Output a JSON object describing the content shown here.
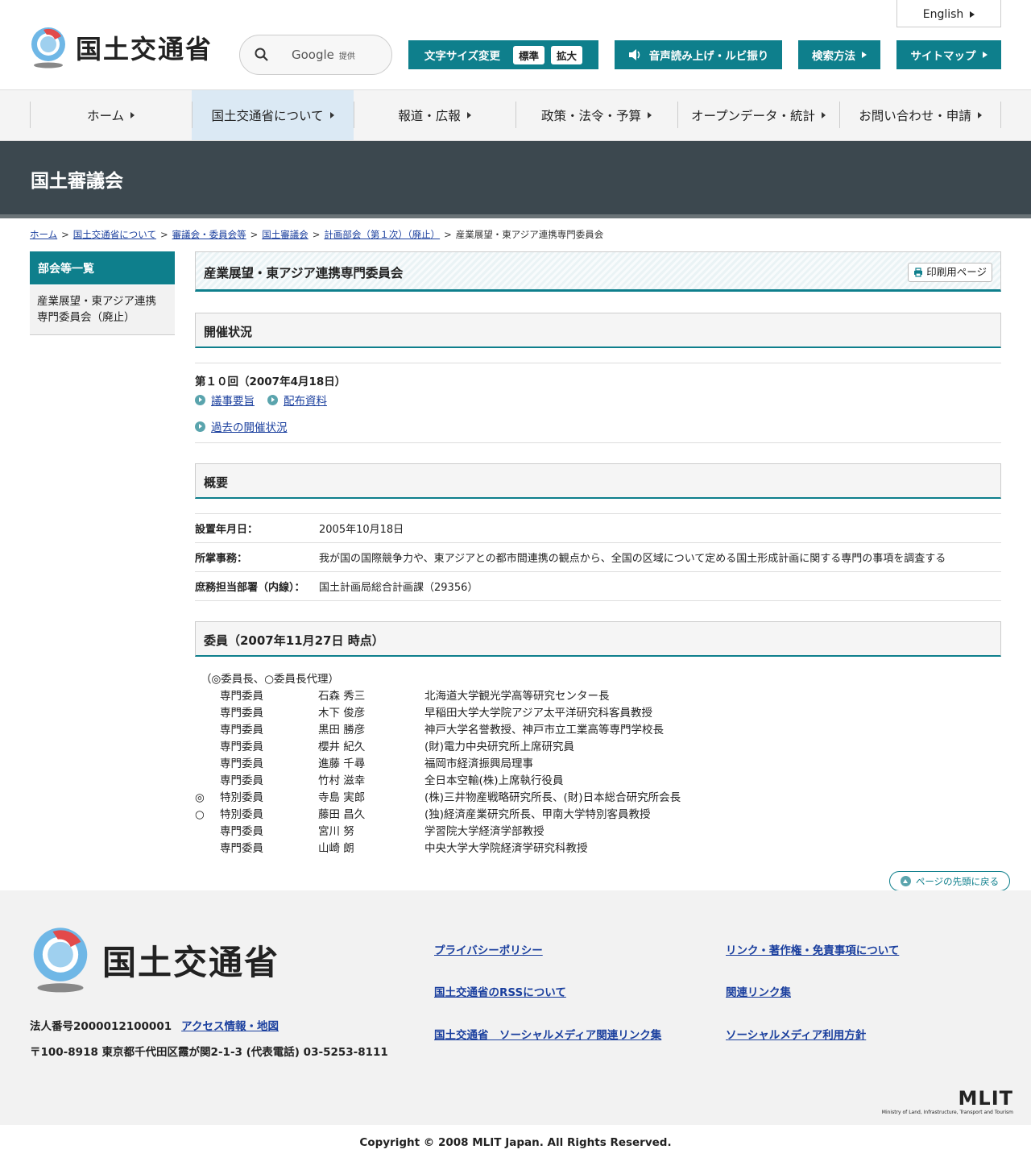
{
  "header": {
    "logo_text": "国土交通省",
    "search_label": "Google",
    "search_sub": "提供",
    "english": "English",
    "font_size_label": "文字サイズ変更",
    "font_standard": "標準",
    "font_large": "拡大",
    "voice": "音声読み上げ・ルビ振り",
    "search_method": "検索方法",
    "sitemap": "サイトマップ"
  },
  "nav": {
    "items": [
      {
        "label": "ホーム"
      },
      {
        "label": "国土交通省について"
      },
      {
        "label": "報道・広報"
      },
      {
        "label": "政策・法令・予算"
      },
      {
        "label": "オープンデータ・統計"
      },
      {
        "label": "お問い合わせ・申請"
      }
    ]
  },
  "band_title": "国土審議会",
  "breadcrumb": {
    "items": [
      "ホーム",
      "国土交通省について",
      "審議会・委員会等",
      "国土審議会",
      "計画部会（第１次）（廃止）"
    ],
    "current": "産業展望・東アジア連携専門委員会"
  },
  "sidebar": {
    "heading": "部会等一覧",
    "item_line1": "産業展望・東アジア連携",
    "item_line2": "専門委員会（廃止）"
  },
  "main": {
    "title": "産業展望・東アジア連携専門委員会",
    "print": "印刷用ページ",
    "sec1": "開催状況",
    "meeting": "第１０回（2007年4月18日）",
    "link_minutes": "議事要旨",
    "link_materials": "配布資料",
    "link_past": "過去の開催状況",
    "sec2": "概要",
    "overview": [
      {
        "k": "設置年月日：",
        "v": "2005年10月18日"
      },
      {
        "k": "所掌事務：",
        "v": "我が国の国際競争力や、東アジアとの都市間連携の観点から、全国の区域について定める国土形成計画に関する専門の事項を調査する"
      },
      {
        "k": "庶務担当部署（内線）：",
        "v": "国土計画局総合計画課（29356）"
      }
    ],
    "sec3": "委員（2007年11月27日 時点）",
    "legend": "（◎委員長、○委員長代理）",
    "members": [
      {
        "mark": "",
        "role": "専門委員",
        "name": "石森 秀三",
        "title": "北海道大学観光学高等研究センター長"
      },
      {
        "mark": "",
        "role": "専門委員",
        "name": "木下 俊彦",
        "title": "早稲田大学大学院アジア太平洋研究科客員教授"
      },
      {
        "mark": "",
        "role": "専門委員",
        "name": "黒田 勝彦",
        "title": "神戸大学名誉教授、神戸市立工業高等専門学校長"
      },
      {
        "mark": "",
        "role": "専門委員",
        "name": "櫻井 紀久",
        "title": "(財)電力中央研究所上席研究員"
      },
      {
        "mark": "",
        "role": "専門委員",
        "name": "進藤 千尋",
        "title": "福岡市経済振興局理事"
      },
      {
        "mark": "",
        "role": "専門委員",
        "name": "竹村 滋幸",
        "title": "全日本空輸(株)上席執行役員"
      },
      {
        "mark": "◎",
        "role": "特別委員",
        "name": "寺島 実郎",
        "title": "(株)三井物産戦略研究所長、(財)日本総合研究所会長"
      },
      {
        "mark": "○",
        "role": "特別委員",
        "name": "藤田 昌久",
        "title": "(独)経済産業研究所長、甲南大学特別客員教授"
      },
      {
        "mark": "",
        "role": "専門委員",
        "name": "宮川 努",
        "title": "学習院大学経済学部教授"
      },
      {
        "mark": "",
        "role": "専門委員",
        "name": "山崎 朗",
        "title": "中央大学大学院経済学研究科教授"
      }
    ],
    "totop": "ページの先頭に戻る"
  },
  "footer": {
    "logo_text": "国土交通省",
    "corp_no": "法人番号2000012100001",
    "access": "アクセス情報・地図",
    "address": "〒100-8918 東京都千代田区霞が関2-1-3 (代表電話) 03-5253-8111",
    "links": [
      "プライバシーポリシー",
      "リンク・著作権・免責事項について",
      "国土交通省のRSSについて",
      "関連リンク集",
      "国土交通省　ソーシャルメディア関連リンク集",
      "ソーシャルメディア利用方針"
    ],
    "mlit": "MLIT",
    "mlit_full": "Ministry of Land, Infrastructure, Transport and Tourism",
    "copyright": "Copyright © 2008 MLIT Japan. All Rights Reserved."
  }
}
